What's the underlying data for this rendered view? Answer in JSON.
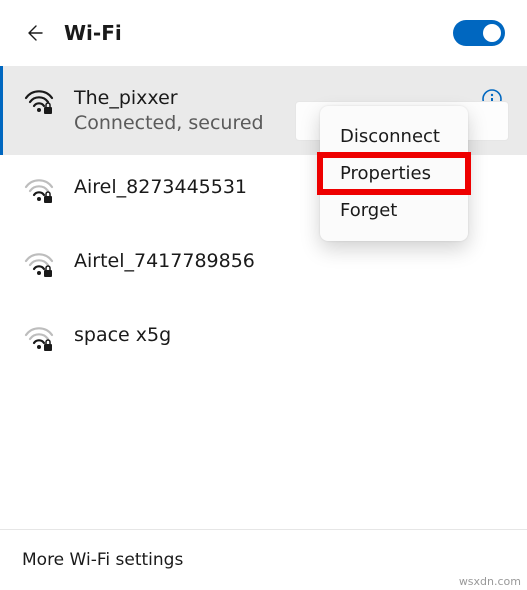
{
  "header": {
    "title": "Wi-Fi",
    "toggle_on": true
  },
  "networks": [
    {
      "name": "The_pixxer",
      "status": "Connected, secured",
      "selected": true,
      "secured": true,
      "strong_signal": true
    },
    {
      "name": "Airel_8273445531",
      "secured": true,
      "strong_signal": false
    },
    {
      "name": "Airtel_7417789856",
      "secured": true,
      "strong_signal": false
    },
    {
      "name": "space x5g",
      "secured": true,
      "strong_signal": false
    }
  ],
  "context_menu": {
    "items": [
      {
        "label": "Disconnect"
      },
      {
        "label": "Properties",
        "highlighted": true
      },
      {
        "label": "Forget"
      }
    ]
  },
  "footer": {
    "more_settings": "More Wi-Fi settings"
  },
  "watermark": "wsxdn.com"
}
